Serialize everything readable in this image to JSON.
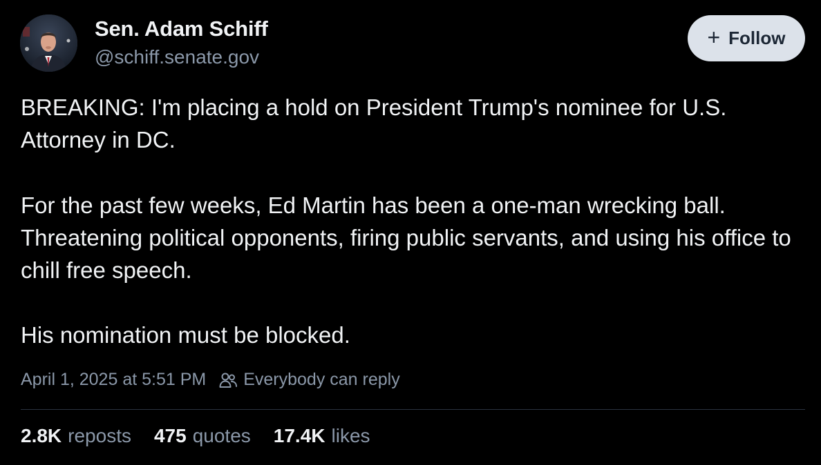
{
  "author": {
    "display_name": "Sen. Adam Schiff",
    "handle": "@schiff.senate.gov",
    "avatar_icon": "profile-photo-avatar"
  },
  "follow_button": {
    "icon": "plus-icon",
    "plus_glyph": "+",
    "label": "Follow"
  },
  "post": {
    "paragraphs": [
      "BREAKING: I'm placing a hold on President Trump's nominee for U.S. Attorney in DC.",
      "For the past few weeks, Ed Martin has been a one-man wrecking ball. Threatening political opponents, firing public servants, and using his office to chill free speech.",
      "His nomination must be blocked."
    ]
  },
  "meta": {
    "timestamp": "April 1, 2025 at 5:51 PM",
    "reply_icon": "people-icon",
    "reply_setting": "Everybody can reply"
  },
  "stats": [
    {
      "value": "2.8K",
      "label": "reposts"
    },
    {
      "value": "475",
      "label": "quotes"
    },
    {
      "value": "17.4K",
      "label": "likes"
    }
  ],
  "colors": {
    "background": "#000000",
    "text_primary": "#f1f3f5",
    "text_secondary": "#8b98a9",
    "button_bg": "#dce2ea",
    "button_text": "#1c2735",
    "divider": "#2b3340"
  }
}
